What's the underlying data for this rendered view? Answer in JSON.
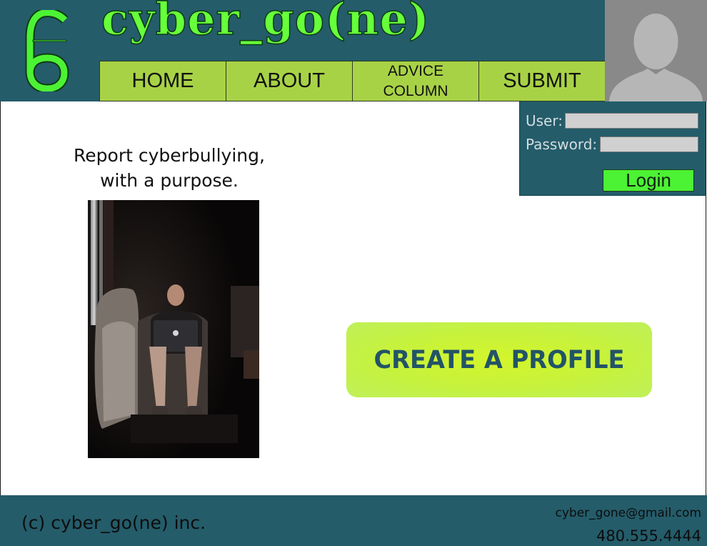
{
  "header": {
    "site_title": "cyber_go(ne)",
    "brand_color": "#67ff3a",
    "background_color": "#245c6a"
  },
  "nav": {
    "items": [
      {
        "label": "HOME"
      },
      {
        "label": "ABOUT"
      },
      {
        "label": "ADVICE\nCOLUMN"
      },
      {
        "label": "SUBMIT"
      }
    ],
    "color": "#a8d246"
  },
  "avatar": {
    "icon": "user-silhouette-icon"
  },
  "login": {
    "user_label": "User:",
    "password_label": "Password:",
    "user_value": "",
    "password_value": "",
    "button_label": "Login",
    "button_color": "#4cf234"
  },
  "hero": {
    "tagline": "Report cyberbullying,\nwith a purpose.",
    "photo": "man-on-laptop-photo"
  },
  "cta": {
    "label": "CREATE A PROFILE",
    "color": "#c6f23e",
    "text_color": "#235466"
  },
  "footer": {
    "copyright": "(c) cyber_go(ne) inc.",
    "email": "cyber_gone@gmail.com",
    "phone": "480.555.4444"
  }
}
